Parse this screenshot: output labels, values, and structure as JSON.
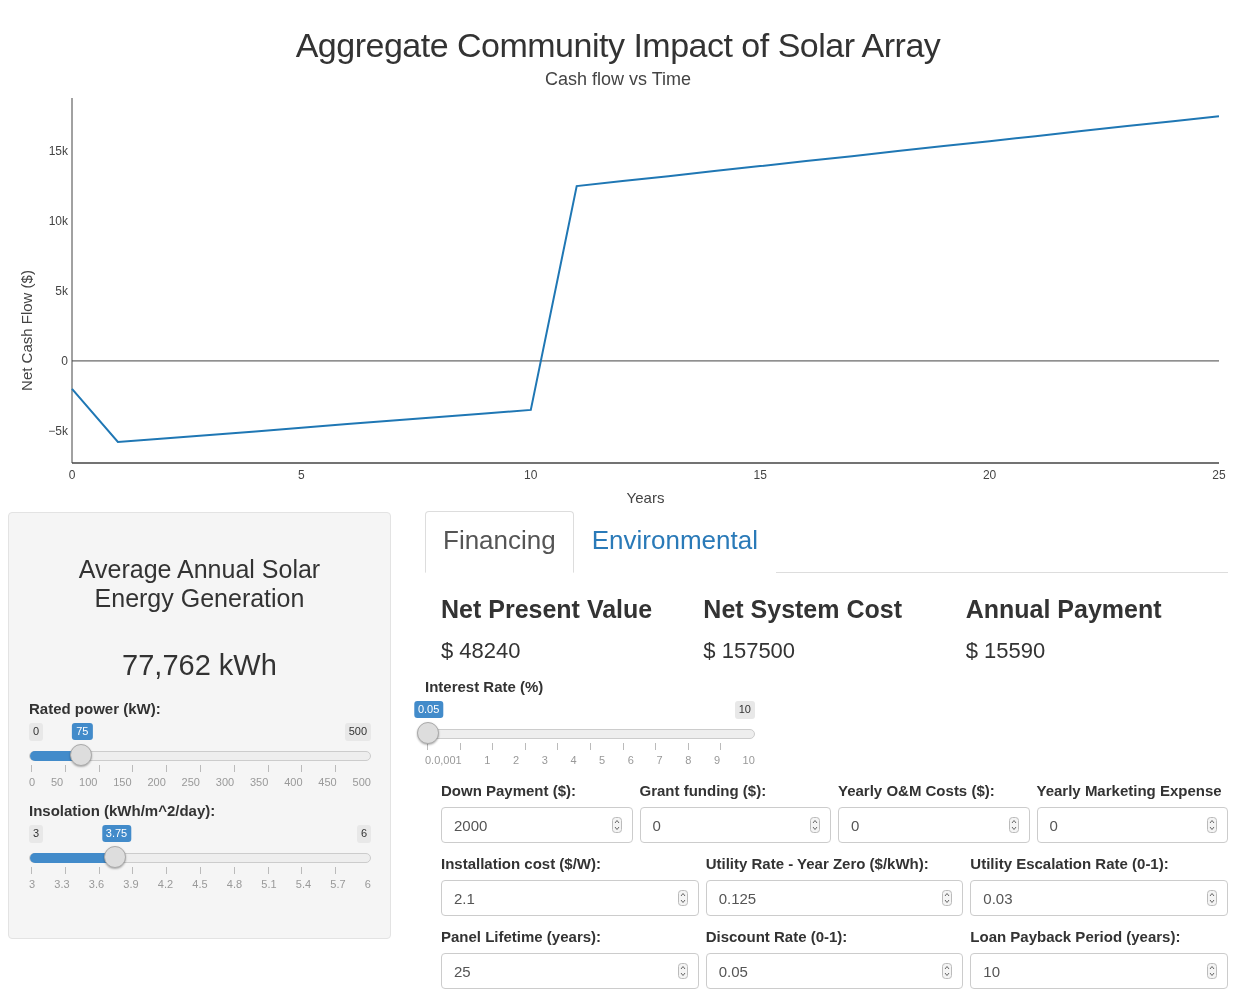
{
  "header": {
    "title": "Aggregate Community Impact of Solar Array",
    "subtitle": "Cash flow vs Time"
  },
  "chart": {
    "chart_data": {
      "type": "line",
      "xlabel": "Years",
      "ylabel": "Net Cash Flow ($)",
      "x": [
        0,
        1,
        2,
        3,
        4,
        5,
        6,
        7,
        8,
        9,
        10,
        11,
        12,
        13,
        14,
        15,
        16,
        17,
        18,
        19,
        20,
        21,
        22,
        23,
        24,
        25
      ],
      "series": [
        {
          "color": "#1f77b4",
          "values": [
            -2000,
            -5800,
            -5550,
            -5300,
            -5040,
            -4780,
            -4520,
            -4270,
            -4010,
            -3760,
            -3500,
            12500,
            12860,
            13210,
            13570,
            13930,
            14290,
            14640,
            15000,
            15360,
            15710,
            16070,
            16430,
            16790,
            17140,
            17500
          ]
        }
      ],
      "xlim": [
        0,
        25
      ],
      "ylim": [
        -7300,
        18800
      ],
      "xticks": [
        0,
        5,
        10,
        15,
        20,
        25
      ],
      "yticks": [
        {
          "value": -5000,
          "label": "−5k"
        },
        {
          "value": 0,
          "label": "0"
        },
        {
          "value": 5000,
          "label": "5k"
        },
        {
          "value": 10000,
          "label": "10k"
        },
        {
          "value": 15000,
          "label": "15k"
        }
      ]
    }
  },
  "energy_panel": {
    "title": "Average Annual Solar Energy Generation",
    "value": "77,762 kWh",
    "sliders": [
      {
        "label": "Rated power (kW):",
        "min": "0",
        "max": "500",
        "value": "75",
        "level": 0.15,
        "ticks": [
          "0",
          "50",
          "100",
          "150",
          "200",
          "250",
          "300",
          "350",
          "400",
          "450",
          "500"
        ]
      },
      {
        "label": "Insolation (kWh/m^2/day):",
        "min": "3",
        "max": "6",
        "value": "3.75",
        "level": 0.25,
        "ticks": [
          "3",
          "3.3",
          "3.6",
          "3.9",
          "4.2",
          "4.5",
          "4.8",
          "5.1",
          "5.4",
          "5.7",
          "6"
        ]
      }
    ]
  },
  "tabs": [
    {
      "label": "Financing",
      "selected": true
    },
    {
      "label": "Environmental",
      "selected": false
    }
  ],
  "metrics": [
    {
      "label": "Net Present Value",
      "value": "$ 48240"
    },
    {
      "label": "Net System Cost",
      "value": "$ 157500"
    },
    {
      "label": "Annual Payment",
      "value": "$ 15590"
    }
  ],
  "interest_slider": {
    "label": "Interest Rate (%)",
    "max": "10",
    "value": "0.05",
    "level": 0.005,
    "ticks": [
      "0.0,001",
      "1",
      "2",
      "3",
      "4",
      "5",
      "6",
      "7",
      "8",
      "9",
      "10"
    ]
  },
  "input_rows": [
    [
      {
        "label": "Down Payment ($):",
        "value": "2000"
      },
      {
        "label": "Grant funding ($):",
        "value": "0"
      },
      {
        "label": "Yearly O&M Costs ($):",
        "value": "0"
      },
      {
        "label": "Yearly Marketing Expense",
        "value": "0"
      }
    ],
    [
      {
        "label": "Installation cost ($/W):",
        "value": "2.1"
      },
      {
        "label": "Utility Rate - Year Zero ($/kWh):",
        "value": "0.125"
      },
      {
        "label": "Utility Escalation Rate (0-1):",
        "value": "0.03"
      }
    ],
    [
      {
        "label": "Panel Lifetime (years):",
        "value": "25"
      },
      {
        "label": "Discount Rate (0-1):",
        "value": "0.05"
      },
      {
        "label": "Loan Payback Period (years):",
        "value": "10"
      }
    ]
  ]
}
